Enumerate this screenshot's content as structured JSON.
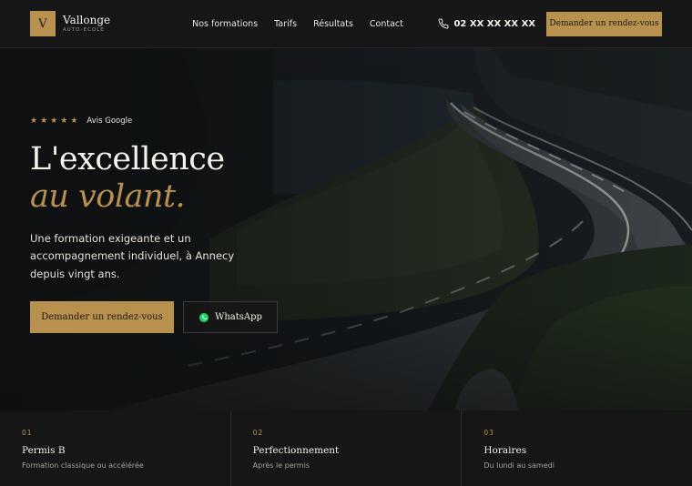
{
  "brand": {
    "mark": "V",
    "name": "Vallonge",
    "tagline": "AUTO-ÉCOLE"
  },
  "nav": {
    "items": [
      {
        "label": "Nos formations"
      },
      {
        "label": "Tarifs"
      },
      {
        "label": "Résultats"
      },
      {
        "label": "Contact"
      }
    ]
  },
  "header": {
    "phone": "02 XX XX XX XX",
    "cta_label": "Demander un rendez-vous"
  },
  "hero": {
    "stars": 5,
    "rating_label": "Avis Google",
    "title_line1": "L'excellence",
    "title_line2": "au volant.",
    "lead": "Une formation exigeante et un accompagnement individuel, à Annecy depuis vingt ans.",
    "primary_cta": "Demander un rendez-vous",
    "secondary_cta": "WhatsApp"
  },
  "features": [
    {
      "num": "01",
      "title": "Permis B",
      "sub": "Formation classique ou accélérée"
    },
    {
      "num": "02",
      "title": "Perfectionnement",
      "sub": "Après le permis"
    },
    {
      "num": "03",
      "title": "Horaires",
      "sub": "Du lundi au samedi"
    }
  ],
  "colors": {
    "accent": "#b8914f",
    "background": "#161616",
    "text": "#f3efe7"
  },
  "icons": {
    "phone": "phone-icon",
    "whatsapp": "whatsapp-icon",
    "star": "star-icon"
  }
}
